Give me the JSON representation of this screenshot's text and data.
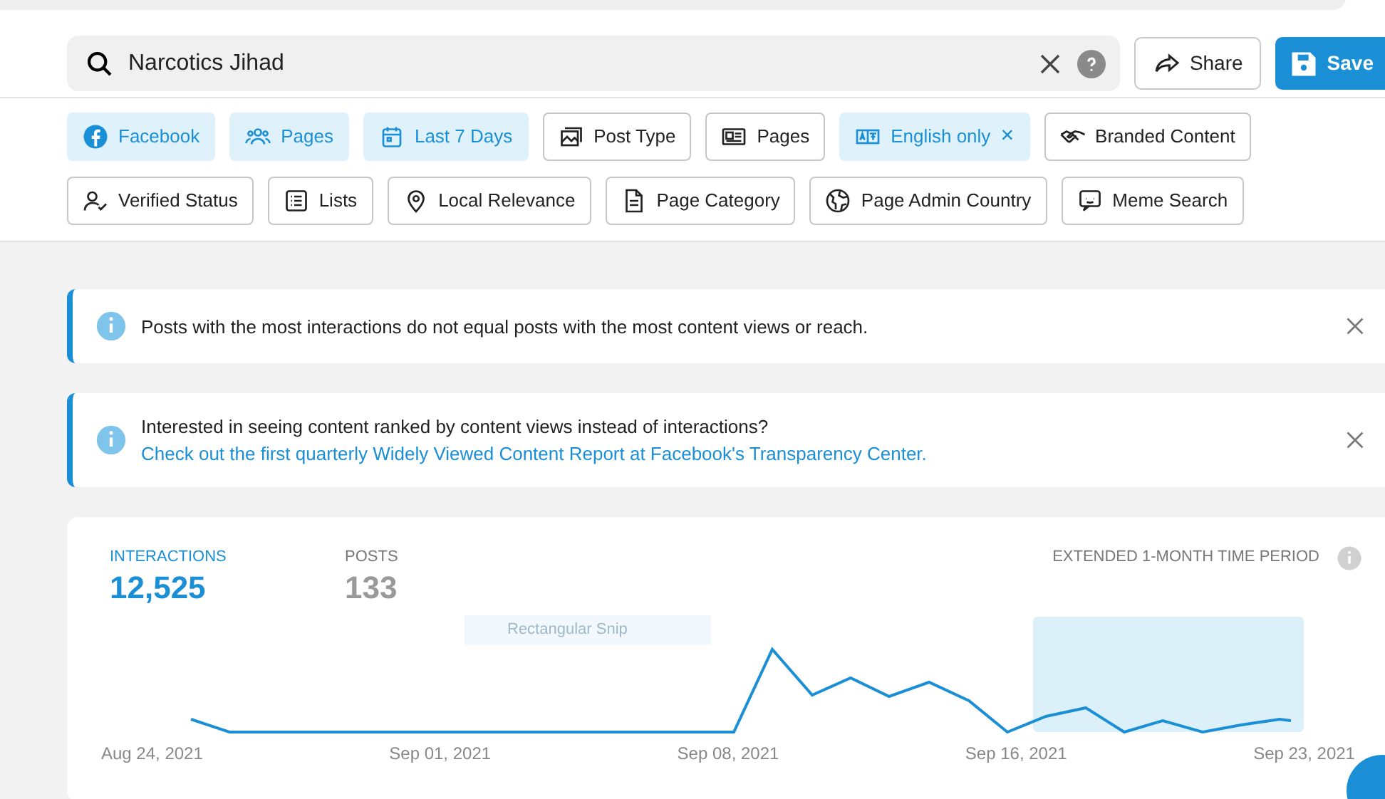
{
  "search": {
    "value": "Narcotics Jihad"
  },
  "actions": [
    {
      "label": "Share",
      "kind": "share"
    },
    {
      "label": "Save",
      "kind": "save"
    }
  ],
  "filter_rows": [
    [
      {
        "label": "Facebook",
        "kind": "facebook",
        "selected": true
      },
      {
        "label": "Pages",
        "kind": "people",
        "selected": true
      },
      {
        "label": "Last 7 Days",
        "kind": "calendar",
        "selected": true
      },
      {
        "label": "Post Type",
        "kind": "images",
        "selected": false
      },
      {
        "label": "Pages",
        "kind": "newspaper",
        "selected": false
      },
      {
        "label": "English only",
        "kind": "language",
        "selected": true,
        "remove": "×"
      },
      {
        "label": "Branded Content",
        "kind": "handshake",
        "selected": false
      }
    ],
    [
      {
        "label": "Verified Status",
        "kind": "user-check",
        "selected": false
      },
      {
        "label": "Lists",
        "kind": "list",
        "selected": false
      },
      {
        "label": "Local Relevance",
        "kind": "pin",
        "selected": false
      },
      {
        "label": "Page Category",
        "kind": "document",
        "selected": false
      },
      {
        "label": "Page Admin Country",
        "kind": "globe",
        "selected": false
      },
      {
        "label": "Meme Search",
        "kind": "chat",
        "selected": false
      }
    ]
  ],
  "notices": [
    {
      "text": "Posts with the most interactions do not equal posts with the most content views or reach."
    },
    {
      "text": "Interested in seeing content ranked by content views instead of interactions?",
      "link": "Check out the first quarterly Widely Viewed Content Report at Facebook's Transparency Center."
    }
  ],
  "stats": [
    {
      "label": "INTERACTIONS",
      "value": "12,525",
      "selected": true
    },
    {
      "label": "POSTS",
      "value": "133",
      "selected": false
    }
  ],
  "period_label": "EXTENDED 1-MONTH TIME PERIOD",
  "snip_hint": "Rectangular Snip",
  "x_labels": [
    "Aug 24, 2021",
    "Sep 01, 2021",
    "Sep 08, 2021",
    "Sep 16, 2021",
    "Sep 23, 2021"
  ]
}
